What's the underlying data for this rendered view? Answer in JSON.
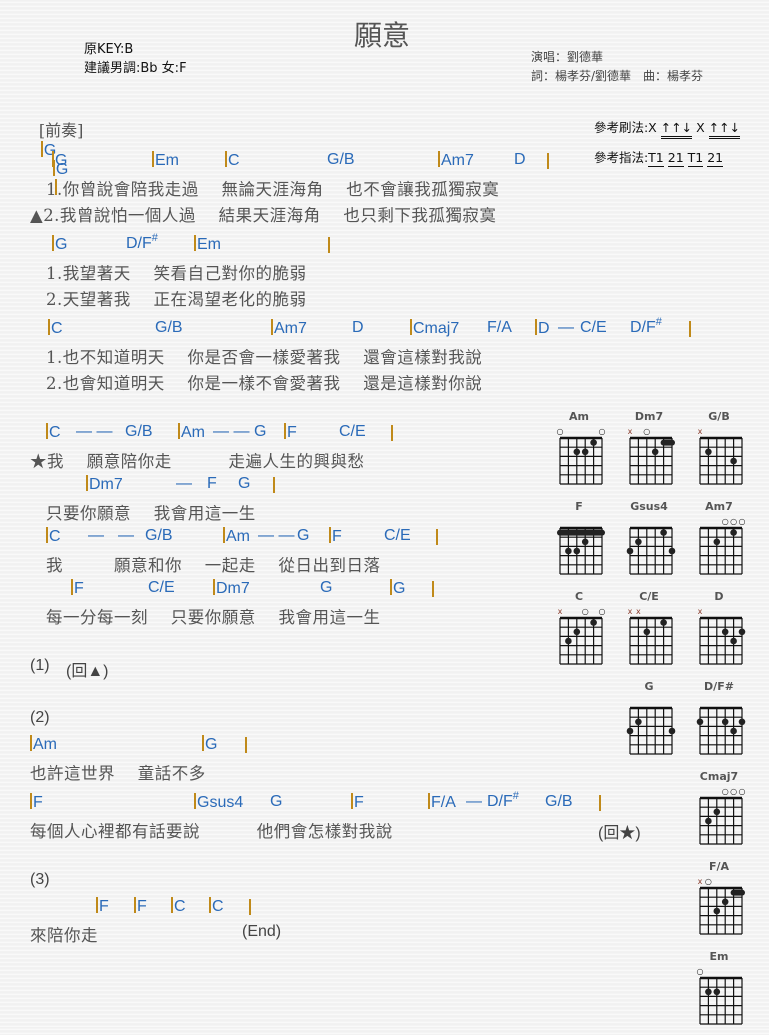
{
  "header": {
    "title": "願意",
    "original_key": "原KEY:B",
    "suggested_key": "建議男調:Bb 女:F",
    "singer": "演唱：劉德華",
    "credits": "詞：楊孝芬/劉德華　曲：楊孝芬",
    "strum_label": "參考刷法:",
    "strum_parts": [
      "X",
      "↑↑↓",
      "X",
      "↑↑↓"
    ],
    "finger_label": "參考指法:",
    "finger_parts": [
      "T1",
      "21",
      "T1",
      "21"
    ]
  },
  "intro": {
    "label": "[前奏]",
    "chords": [
      "G",
      "G"
    ]
  },
  "sections": {
    "verse1_chords": [
      "G",
      "Em",
      "C",
      "G/B",
      "Am7",
      "D"
    ],
    "verse1_lyrics_1": "1.你曾說會陪我走過　 無論天涯海角　 也不會讓我孤獨寂寞",
    "verse1_lyrics_2": "▲2.我曾說怕一個人過　 結果天涯海角　 也只剩下我孤獨寂寞",
    "verse2_chords": [
      "G",
      "D/F#",
      "Em"
    ],
    "verse2_lyrics_1": "1.我望著天　 笑看自己對你的脆弱",
    "verse2_lyrics_2": "2.天望著我　 正在渴望老化的脆弱",
    "verse3_chords": [
      "C",
      "G/B",
      "Am7",
      "D",
      "Cmaj7",
      "F/A",
      "D",
      "—",
      "C/E",
      "D/F#"
    ],
    "verse3_lyrics_1": "1.也不知道明天　 你是否會一樣愛著我　 還會這樣對我說",
    "verse3_lyrics_2": "2.也會知道明天　 你是一樣不會愛著我　 還是這樣對你說",
    "chorus_chords_1": [
      "C",
      "— —",
      "G/B",
      "Am",
      "— —",
      "G",
      "F",
      "C/E"
    ],
    "chorus_lyrics_1": "★我　 願意陪你走　　　 走遍人生的興與愁",
    "chorus_chords_2": [
      "Dm7",
      "—",
      "F",
      "G"
    ],
    "chorus_lyrics_2": "只要你願意　 我會用這一生",
    "chorus_chords_3": [
      "C",
      "—",
      "—",
      "G/B",
      "Am",
      "— —",
      "G",
      "F",
      "C/E"
    ],
    "chorus_lyrics_3": "我　　　願意和你　 一起走　 從日出到日落",
    "chorus_chords_4": [
      "F",
      "C/E",
      "Dm7",
      "G",
      "G"
    ],
    "chorus_lyrics_4": "每一分每一刻　 只要你願意　 我會用這一生",
    "part1_label": "(1)",
    "part1_note": "(回▲)",
    "part2_label": "(2)",
    "bridge_chords_1": [
      "Am",
      "G"
    ],
    "bridge_lyrics_1": "也許這世界　 童話不多",
    "bridge_chords_2": [
      "F",
      "Gsus4",
      "G",
      "F",
      "F/A",
      "—",
      "D/F#",
      "G/B"
    ],
    "bridge_lyrics_2": "每個人心裡都有話要說　　　 他們會怎樣對我說",
    "bridge_note": "(回★)",
    "part3_label": "(3)",
    "outro_chords": [
      "F",
      "F",
      "C",
      "C"
    ],
    "outro_lyrics": "來陪你走",
    "outro_note": "(End)"
  },
  "chord_charts": [
    {
      "name": "Am",
      "top": [
        "",
        "x?",
        "o",
        "",
        "",
        "",
        "o"
      ],
      "markers": "oxxxxo"
    },
    {
      "name": "Dm7",
      "markers": "xxo"
    },
    {
      "name": "G/B",
      "markers": "x"
    },
    {
      "name": "F",
      "markers": ""
    },
    {
      "name": "Gsus4",
      "markers": ""
    },
    {
      "name": "Am7",
      "markers": "ooo"
    },
    {
      "name": "C",
      "markers": "xoo"
    },
    {
      "name": "C/E",
      "markers": "xx"
    },
    {
      "name": "D",
      "markers": "x"
    },
    {
      "name": "G",
      "markers": ""
    },
    {
      "name": "D/F#",
      "markers": ""
    },
    {
      "name": "Cmaj7",
      "markers": "ooo"
    },
    {
      "name": "F/A",
      "markers": "xo"
    },
    {
      "name": "Em",
      "markers": "o"
    }
  ],
  "colors": {
    "chord": "#2a6ab8",
    "barline": "#c08a1a",
    "lyric": "#555555"
  }
}
